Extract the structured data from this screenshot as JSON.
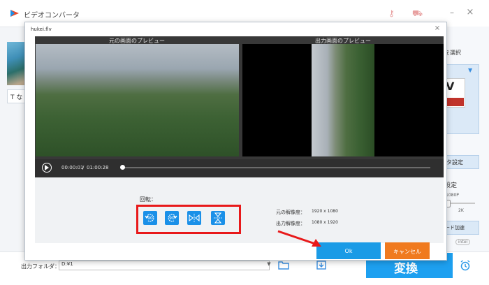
{
  "app": {
    "title": "ビデオコンバータ",
    "icons": {
      "logo": "app-logo-icon",
      "key": "key-icon",
      "cart": "cart-icon",
      "minimize": "minimize-icon",
      "close": "close-icon"
    },
    "plus_label": "+",
    "text_tab_label": "T な"
  },
  "right_panel": {
    "select_label": "を選択",
    "format_text": "V",
    "meta_label": "タ設定",
    "settings_label": "設定",
    "res_min": "1080P",
    "res_max": "2K",
    "accel_label": "ード加速",
    "intel_badge": "intel"
  },
  "bottom": {
    "output_label": "出力フォルダ：",
    "output_value": "D:¥1",
    "convert_label": "変換"
  },
  "dialog": {
    "file_name": "hukei.flv",
    "close_glyph": "×",
    "original_preview_label": "元の画面のプレビュー",
    "output_preview_label": "出力画面のプレビュー",
    "time_current": "00:00:01",
    "time_separator": "/",
    "time_total": "01:00:28",
    "rotate_label": "回転：",
    "rotate_buttons": [
      {
        "name": "rotate-left-90",
        "text": "90"
      },
      {
        "name": "rotate-right-90",
        "text": "90"
      },
      {
        "name": "flip-horizontal",
        "text": "▷◁"
      },
      {
        "name": "flip-vertical",
        "text": "⧗"
      }
    ],
    "original_res_label": "元の解像度：",
    "original_res_value": "1920 x 1080",
    "output_res_label": "出力解像度：",
    "output_res_value": "1080 x 1920",
    "ok_label": "Ok",
    "cancel_label": "キャンセル"
  },
  "colors": {
    "accent_blue": "#1a9be6",
    "highlight_red": "#e8191a",
    "cancel_orange": "#f07a1e"
  }
}
